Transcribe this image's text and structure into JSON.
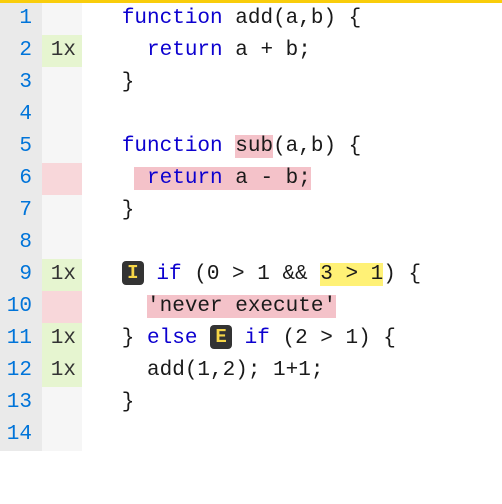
{
  "lines": [
    {
      "ln": "1",
      "cov": "",
      "cov_class": ""
    },
    {
      "ln": "2",
      "cov": "1x",
      "cov_class": "hit"
    },
    {
      "ln": "3",
      "cov": "",
      "cov_class": ""
    },
    {
      "ln": "4",
      "cov": "",
      "cov_class": ""
    },
    {
      "ln": "5",
      "cov": "",
      "cov_class": ""
    },
    {
      "ln": "6",
      "cov": "",
      "cov_class": "miss"
    },
    {
      "ln": "7",
      "cov": "",
      "cov_class": ""
    },
    {
      "ln": "8",
      "cov": "",
      "cov_class": ""
    },
    {
      "ln": "9",
      "cov": "1x",
      "cov_class": "hit"
    },
    {
      "ln": "10",
      "cov": "",
      "cov_class": "miss"
    },
    {
      "ln": "11",
      "cov": "1x",
      "cov_class": "hit"
    },
    {
      "ln": "12",
      "cov": "1x",
      "cov_class": "hit"
    },
    {
      "ln": "13",
      "cov": "",
      "cov_class": ""
    },
    {
      "ln": "14",
      "cov": "",
      "cov_class": ""
    }
  ],
  "code": {
    "l1_kw1": "function",
    "l1_fn": "add",
    "l1_rest": "(a,b) {",
    "l2_kw": "return",
    "l2_rest": " a + b;",
    "l3": "   }",
    "l5_kw1": "function",
    "l5_fn": "sub",
    "l5_rest": "(a,b) {",
    "l6_kw": "return",
    "l6_rest": " a - b;",
    "l7": "   }",
    "l9_badge": "I",
    "l9_kw": "if",
    "l9_p1": " (0 > 1 && ",
    "l9_hl": "3 > 1",
    "l9_p2": ") {",
    "l10_str": "'never execute'",
    "l11_a": "   } ",
    "l11_kw1": "else",
    "l11_badge": "E",
    "l11_kw2": "if",
    "l11_b": " (2 > 1) {",
    "l12": "     add(1,2); 1+1;",
    "l13": "   }"
  }
}
